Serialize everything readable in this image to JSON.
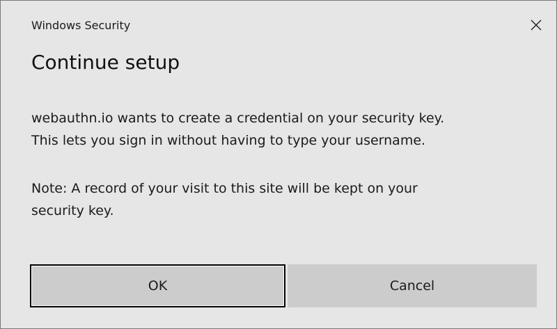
{
  "dialog": {
    "window_title": "Windows Security",
    "heading": "Continue setup",
    "paragraph_1": [
      "webauthn.io wants to create a credential on your security key.",
      "This lets you sign in without having to type your username."
    ],
    "paragraph_2": [
      "Note: A record of your visit to this site will be kept on your",
      "security key."
    ],
    "close_icon": "close-x-icon"
  },
  "buttons": {
    "ok_label": "OK",
    "cancel_label": "Cancel"
  },
  "colors": {
    "background": "#e6e6e6",
    "button": "#cccccc",
    "focus_border": "#000000"
  }
}
